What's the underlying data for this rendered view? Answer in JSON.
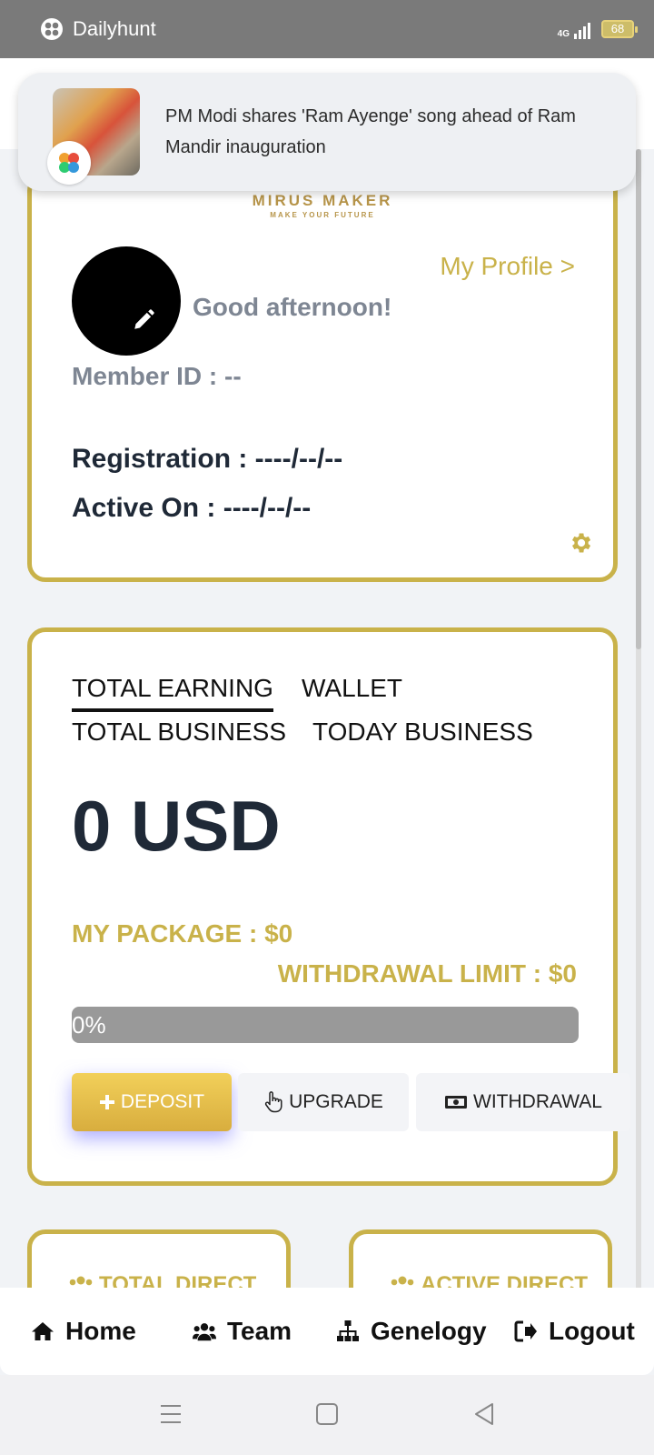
{
  "status_bar": {
    "app_name": "Dailyhunt",
    "network": "4G",
    "battery": "68"
  },
  "notification": {
    "text": "PM Modi shares 'Ram Ayenge' song ahead of Ram Mandir inauguration"
  },
  "profile": {
    "brand_line1": "MIRUS MAKER",
    "brand_line2": "MAKE YOUR FUTURE",
    "my_profile_link": "My Profile >",
    "greeting": "Good afternoon!",
    "member_id": "Member ID : --",
    "registration": "Registration : ----/--/--",
    "active_on": "Active On : ----/--/--"
  },
  "earning": {
    "tabs": [
      {
        "label": "TOTAL EARNING",
        "active": true
      },
      {
        "label": "WALLET",
        "active": false
      },
      {
        "label": "TOTAL BUSINESS",
        "active": false
      },
      {
        "label": "TODAY BUSINESS",
        "active": false
      }
    ],
    "amount": "0 USD",
    "package": "MY PACKAGE : $0",
    "withdrawal_limit": "WITHDRAWAL LIMIT : $0",
    "progress_label": "0%",
    "progress_value": 0,
    "buttons": {
      "deposit": "DEPOSIT",
      "upgrade": "UPGRADE",
      "withdrawal": "WITHDRAWAL"
    }
  },
  "stats": {
    "left_title": "TOTAL DIRECT",
    "right_title": "ACTIVE DIRECT"
  },
  "bottom_nav": {
    "home": "Home",
    "team": "Team",
    "genelogy": "Genelogy",
    "logout": "Logout"
  },
  "colors": {
    "accent": "#c9b24a",
    "dark_text": "#1f2937",
    "muted_text": "#7e8693",
    "status_bar": "#7a7a7a"
  }
}
